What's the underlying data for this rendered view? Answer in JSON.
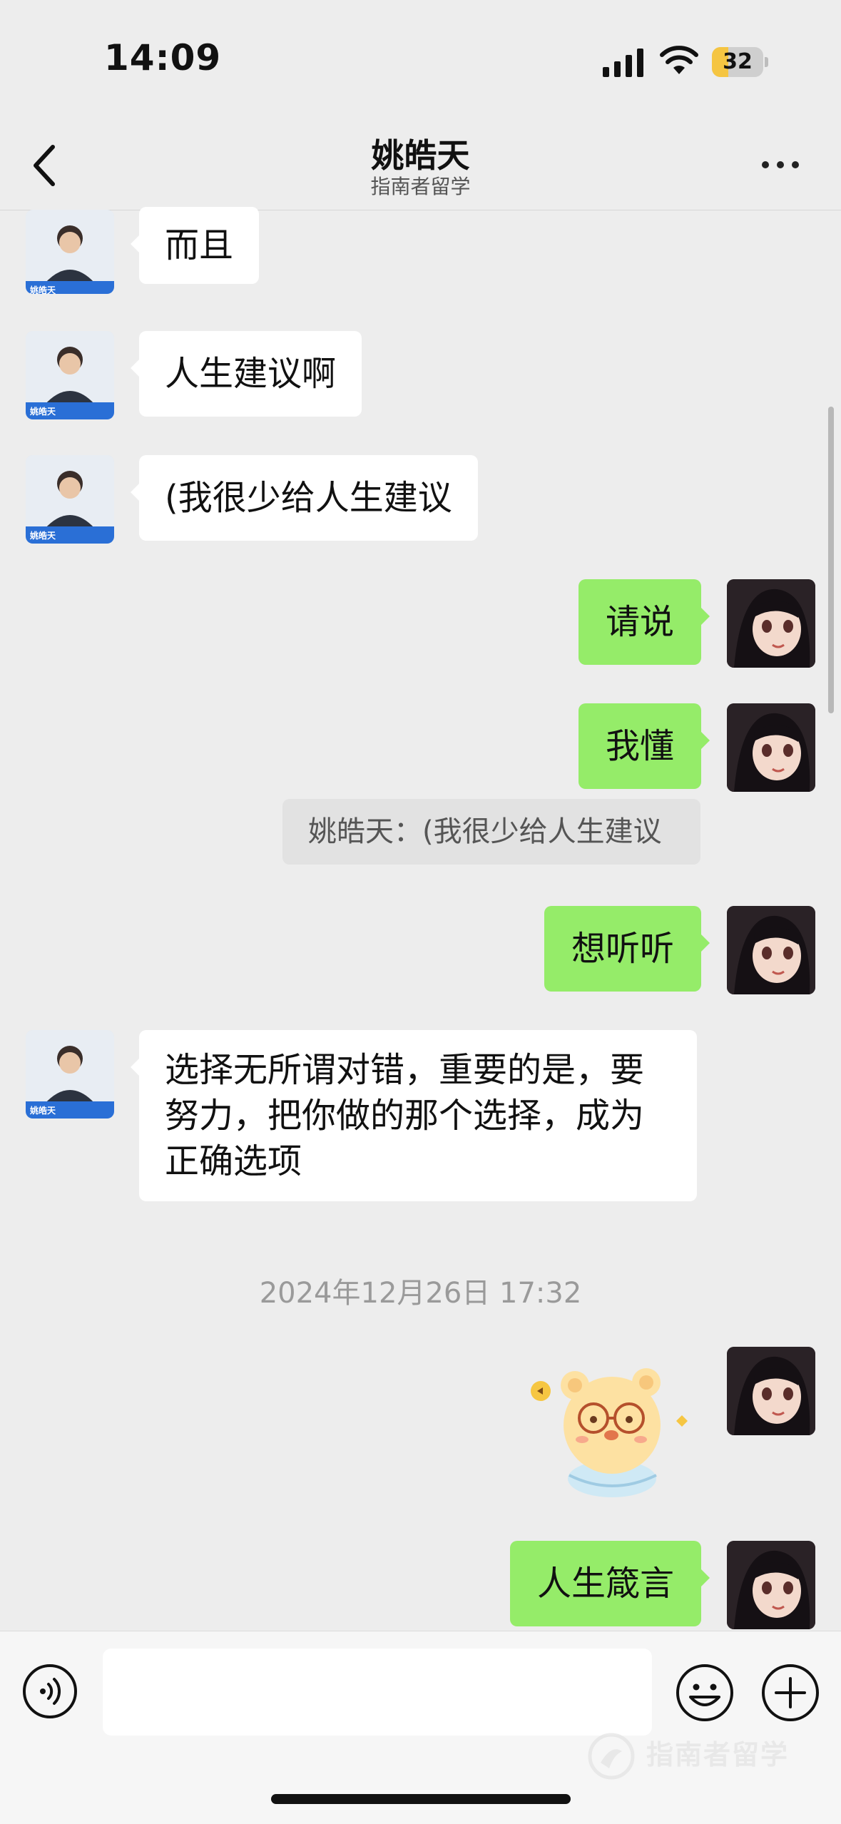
{
  "status_bar": {
    "time": "14:09",
    "battery": "32",
    "battery_level": 0.32
  },
  "header": {
    "title": "姚皓天",
    "subtitle": "指南者留学"
  },
  "messages": [
    {
      "text": "而且"
    },
    {
      "text": "人生建议啊"
    },
    {
      "text": "(我很少给人生建议"
    },
    {
      "text": "请说"
    },
    {
      "text": "我懂"
    },
    {
      "quote": "姚皓天：(我很少给人生建议"
    },
    {
      "text": "想听听"
    },
    {
      "lines": [
        "选择无所谓对错，重要的是，要",
        "努力，把你做的那个选择，成为",
        "正确选项"
      ]
    },
    {
      "text": "人生箴言"
    }
  ],
  "timestamp": "2024年12月26日 17:32",
  "sticker": {
    "icon": "bear-sticker"
  },
  "avatar_card": {
    "name": "姚皓天"
  },
  "input": {
    "placeholder": ""
  },
  "watermark": {
    "text": "指南者留学"
  },
  "colors": {
    "outgoing_bubble": "#95ec69",
    "incoming_bubble": "#ffffff",
    "background": "#ededed"
  }
}
